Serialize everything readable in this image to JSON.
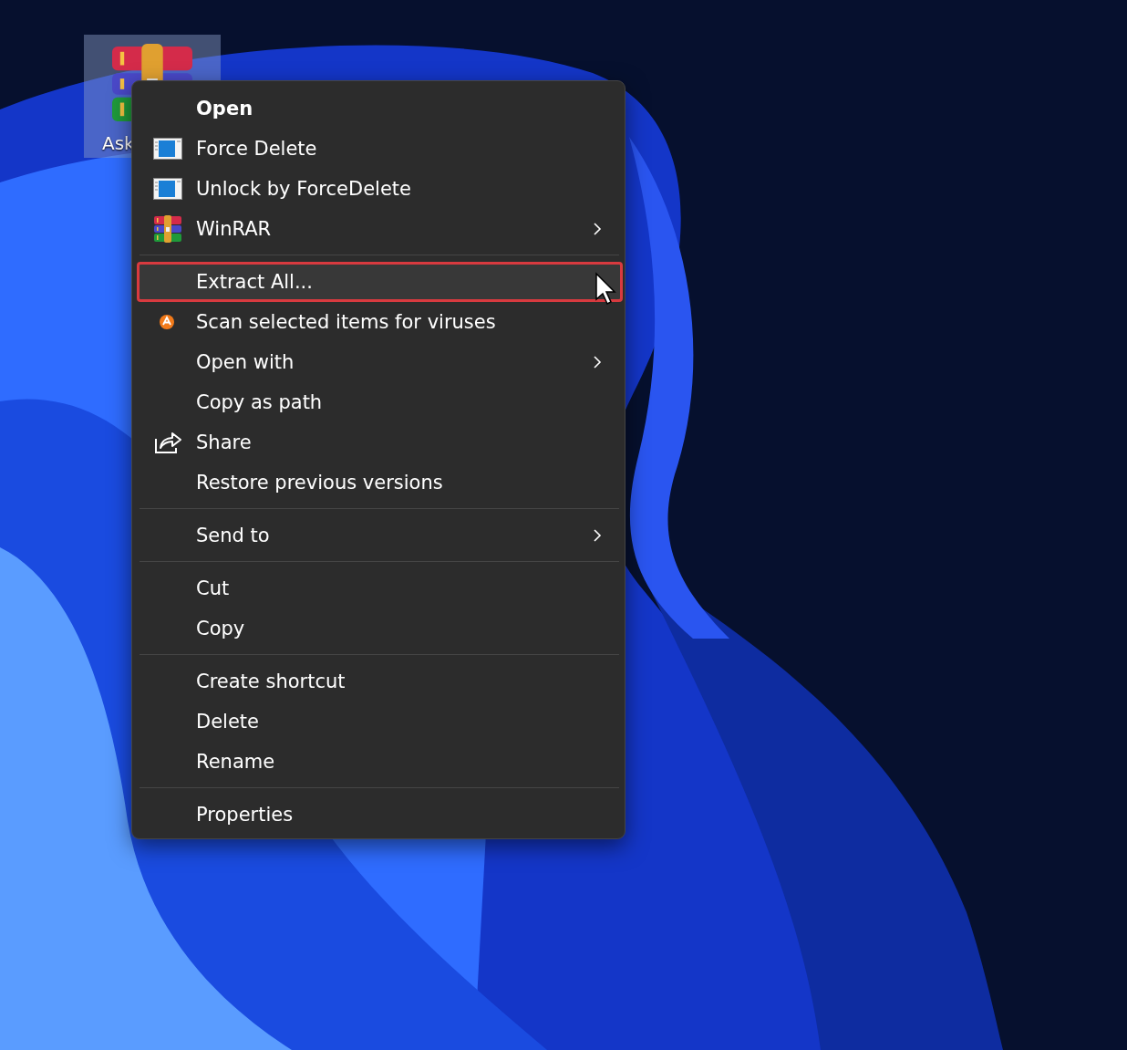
{
  "desktop_icon": {
    "label": "Ask"
  },
  "context_menu": {
    "groups": [
      {
        "items": [
          {
            "label": "Open",
            "kind": "none",
            "default": true,
            "submenu": false,
            "selected": false
          },
          {
            "label": "Force Delete",
            "kind": "forcedelete",
            "default": false,
            "submenu": false,
            "selected": false
          },
          {
            "label": "Unlock by ForceDelete",
            "kind": "forcedelete",
            "default": false,
            "submenu": false,
            "selected": false
          },
          {
            "label": "WinRAR",
            "kind": "winrar",
            "default": false,
            "submenu": true,
            "selected": false
          }
        ]
      },
      {
        "items": [
          {
            "label": "Extract All...",
            "kind": "none",
            "default": false,
            "submenu": false,
            "selected": true
          },
          {
            "label": "Scan selected items for viruses",
            "kind": "antivirus",
            "default": false,
            "submenu": false,
            "selected": false
          },
          {
            "label": "Open with",
            "kind": "none",
            "default": false,
            "submenu": true,
            "selected": false
          },
          {
            "label": "Copy as path",
            "kind": "none",
            "default": false,
            "submenu": false,
            "selected": false
          },
          {
            "label": "Share",
            "kind": "share",
            "default": false,
            "submenu": false,
            "selected": false
          },
          {
            "label": "Restore previous versions",
            "kind": "none",
            "default": false,
            "submenu": false,
            "selected": false
          }
        ]
      },
      {
        "items": [
          {
            "label": "Send to",
            "kind": "none",
            "default": false,
            "submenu": true,
            "selected": false
          }
        ]
      },
      {
        "items": [
          {
            "label": "Cut",
            "kind": "none",
            "default": false,
            "submenu": false,
            "selected": false
          },
          {
            "label": "Copy",
            "kind": "none",
            "default": false,
            "submenu": false,
            "selected": false
          }
        ]
      },
      {
        "items": [
          {
            "label": "Create shortcut",
            "kind": "none",
            "default": false,
            "submenu": false,
            "selected": false
          },
          {
            "label": "Delete",
            "kind": "none",
            "default": false,
            "submenu": false,
            "selected": false
          },
          {
            "label": "Rename",
            "kind": "none",
            "default": false,
            "submenu": false,
            "selected": false
          }
        ]
      },
      {
        "items": [
          {
            "label": "Properties",
            "kind": "none",
            "default": false,
            "submenu": false,
            "selected": false
          }
        ]
      }
    ]
  }
}
